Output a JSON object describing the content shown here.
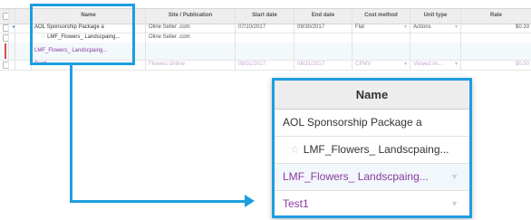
{
  "grid": {
    "columns": [
      "Name",
      "Site / Publication",
      "Start date",
      "End date",
      "Cost method",
      "Unit type",
      "Rate"
    ],
    "rows": [
      {
        "name": "AOL Sponsorship Package a",
        "site": "Oline Seller .com",
        "start": "07/10/2017",
        "end": "09/30/2017",
        "cost": "Flat",
        "unit": "Actions",
        "rate": "$0.33"
      },
      {
        "name": "LMF_Flowers_ Landscpaing...",
        "site": "Oline Seller .com",
        "start": "",
        "end": "",
        "cost": "",
        "unit": "",
        "rate": ""
      },
      {
        "name": "LMF_Flowers_ Landscpaing...",
        "site": "",
        "start": "",
        "end": "",
        "cost": "",
        "unit": "",
        "rate": ""
      },
      {
        "name": "Test1",
        "site": "Flowers Online",
        "start": "08/01/2017",
        "end": "08/31/2017",
        "cost": "CPMV",
        "unit": "Viewed im...",
        "rate": "$0.50"
      }
    ]
  },
  "zoom": {
    "header": "Name",
    "rows": [
      {
        "label": "AOL Sponsorship Package a"
      },
      {
        "label": "LMF_Flowers_ Landscpaing..."
      },
      {
        "label": "LMF_Flowers_ Landscpaing..."
      },
      {
        "label": "Test1"
      }
    ]
  },
  "colors": {
    "accent": "#1e9ee0",
    "purple": "#8a3aa0",
    "header_bg": "#eeeeee"
  }
}
